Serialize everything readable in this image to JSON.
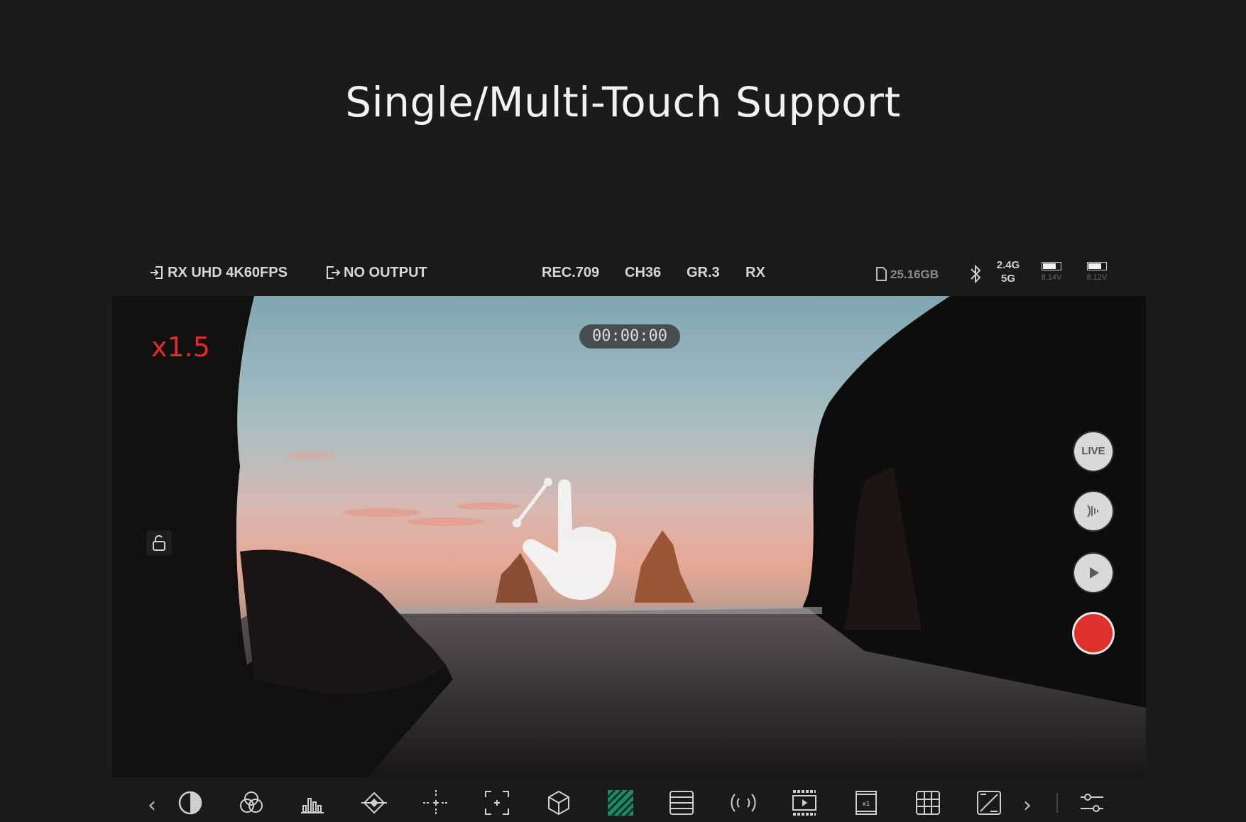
{
  "headline": "Single/Multi-Touch Support",
  "status_bar": {
    "input": "RX UHD 4K60FPS",
    "output": "NO OUTPUT",
    "color_space": "REC.709",
    "channel": "CH36",
    "group": "GR.3",
    "mode": "RX",
    "storage": "25.16GB",
    "band_top": "2.4G",
    "band_bottom": "5G",
    "battery_1_voltage": "8.14V",
    "battery_2_voltage": "8.12V"
  },
  "viewport": {
    "zoom": "x1.5",
    "timecode": "00:00:00"
  },
  "side_controls": {
    "live_label": "LIVE",
    "audio_icon": "audio-wave-icon",
    "play_icon": "play-icon",
    "record_icon": "record-icon",
    "record_color": "#e0302e"
  },
  "toolbar": {
    "icons": [
      "chevron-left-icon",
      "contrast-icon",
      "rgb-circles-icon",
      "histogram-icon",
      "vectorscope-icon",
      "center-marker-icon",
      "focus-frame-icon",
      "3d-lut-icon",
      "zebra-icon",
      "waveform-icon",
      "anamorphic-icon",
      "film-strip-icon",
      "frame-guide-icon",
      "grid-icon",
      "false-color-icon",
      "chevron-right-icon",
      "settings-sliders-icon"
    ],
    "zebra_color": "#1e8a6a"
  }
}
